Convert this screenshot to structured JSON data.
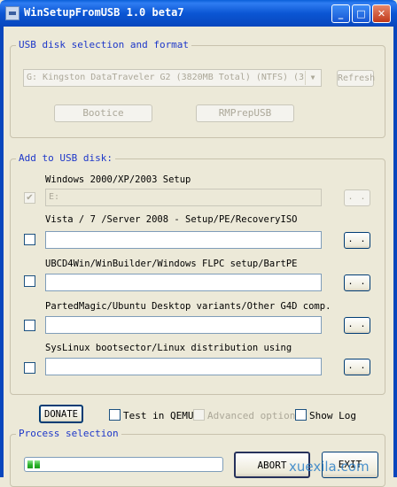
{
  "window": {
    "title": "WinSetupFromUSB 1.0 beta7",
    "buttons": {
      "minimize": "_",
      "maximize": "□",
      "close": "✕"
    }
  },
  "usb_group": {
    "legend": "USB disk selection and format",
    "disk_combo_value": "G: Kingston DataTraveler G2 (3820MB Total) (NTFS) (3",
    "refresh_label": "Refresh",
    "bootice_label": "Bootice",
    "rmprep_label": "RMPrepUSB"
  },
  "add_group": {
    "legend": "Add to USB disk:",
    "items": [
      {
        "label": "Windows 2000/XP/2003 Setup",
        "value": "E:",
        "checked": true,
        "enabled": false,
        "browse": ". ."
      },
      {
        "label": "Vista / 7 /Server 2008 - Setup/PE/RecoveryISO",
        "value": "",
        "checked": false,
        "enabled": true,
        "browse": ". ."
      },
      {
        "label": "UBCD4Win/WinBuilder/Windows FLPC setup/BartPE",
        "value": "",
        "checked": false,
        "enabled": true,
        "browse": ". ."
      },
      {
        "label": "PartedMagic/Ubuntu Desktop variants/Other G4D comp.",
        "value": "",
        "checked": false,
        "enabled": true,
        "browse": ". ."
      },
      {
        "label": "SysLinux bootsector/Linux distribution using",
        "value": "",
        "checked": false,
        "enabled": true,
        "browse": ". ."
      }
    ]
  },
  "options": {
    "donate_label": "DONATE",
    "test_qemu_label": "Test in QEMU",
    "advanced_label": "Advanced options",
    "show_log_label": "Show Log"
  },
  "process_group": {
    "legend": "Process selection",
    "progress_fraction": 0.07,
    "abort_label": "ABORT",
    "exit_label": "EXIT"
  },
  "watermark": "xuexila.com",
  "colors": {
    "title_bar": "#0a5fd8",
    "group_legend": "#1d37c9",
    "window_bg": "#ece9d8"
  }
}
